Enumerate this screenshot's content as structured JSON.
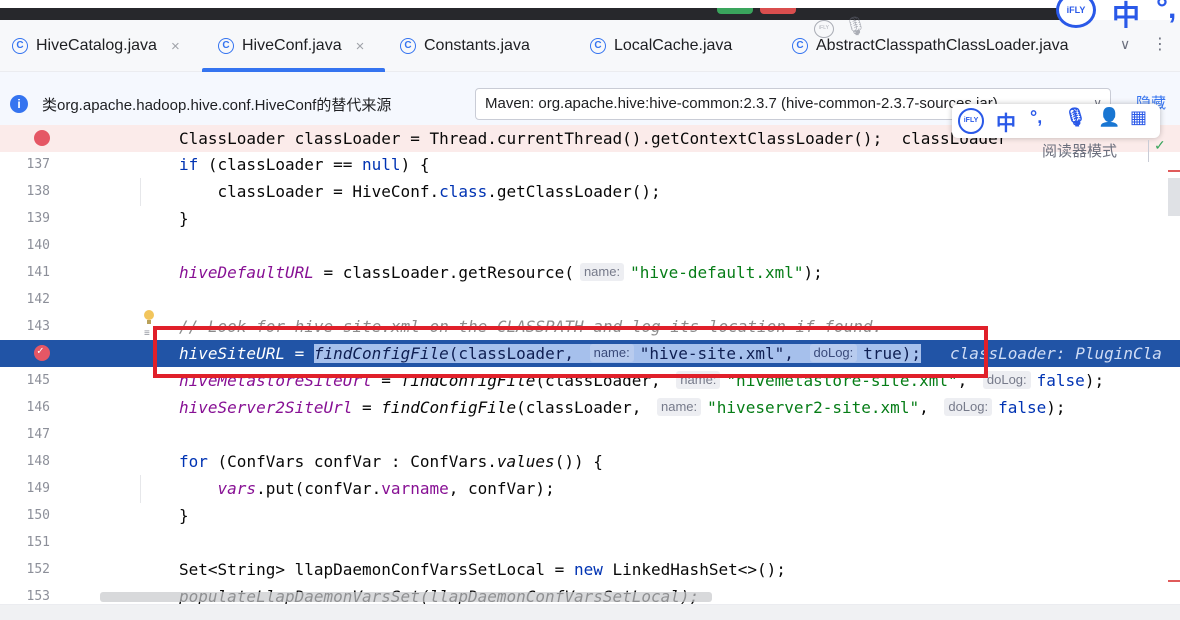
{
  "tabs": [
    {
      "label": "HiveCatalog.java",
      "closable": true,
      "active": false
    },
    {
      "label": "HiveConf.java",
      "closable": true,
      "active": true
    },
    {
      "label": "Constants.java",
      "closable": false,
      "active": false
    },
    {
      "label": "LocalCache.java",
      "closable": false,
      "active": false
    },
    {
      "label": "AbstractClasspathClassLoader.java",
      "closable": false,
      "active": false
    }
  ],
  "tab_icon_glyph": "C",
  "info_bar": {
    "message": "类org.apache.hadoop.hive.conf.HiveConf的替代来源",
    "source_select_value": "Maven: org.apache.hive:hive-common:2.3.7 (hive-common-2.3.7-sources.jar)",
    "hide_link": "隐藏"
  },
  "ifly": {
    "logo_text": "iFLY",
    "lang_label": "中",
    "punct_label": "°,",
    "reader_mode": "阅读器模式"
  },
  "code_lines": [
    {
      "no": "",
      "text": "ClassLoader classLoader = Thread.currentThread().getContextClassLoader();  classLoader"
    },
    {
      "no": "137",
      "text": "if (classLoader == null) {"
    },
    {
      "no": "138",
      "text": "classLoader = HiveConf.class.getClassLoader();"
    },
    {
      "no": "139",
      "text": "}"
    },
    {
      "no": "140",
      "text": ""
    },
    {
      "no": "141",
      "hint_name": "name:",
      "str": "\"hive-default.xml\""
    },
    {
      "no": "142",
      "text": ""
    },
    {
      "no": "143",
      "text": "// Look for hive-site.xml on the CLASSPATH and log its location if found."
    },
    {
      "no": "",
      "hint_name": "name:",
      "str": "\"hive-site.xml\"",
      "hint_dolog": "doLog:",
      "bool": "true",
      "debug": "classLoader: PluginCla"
    },
    {
      "no": "145",
      "hint_name": "name:",
      "str": "\"hivemetastore-site.xml\"",
      "hint_dolog": "doLog:",
      "bool": "false"
    },
    {
      "no": "146",
      "hint_name": "name:",
      "str": "\"hiveserver2-site.xml\"",
      "hint_dolog": "doLog:",
      "bool": "false"
    },
    {
      "no": "147",
      "text": ""
    },
    {
      "no": "148",
      "text": "for (ConfVars confVar : ConfVars.values()) {"
    },
    {
      "no": "149",
      "text": "vars.put(confVar.varname, confVar);"
    },
    {
      "no": "150",
      "text": "}"
    },
    {
      "no": "151",
      "text": ""
    },
    {
      "no": "152",
      "text": "Set<String> llapDaemonConfVarsSetLocal = new LinkedHashSet<>();"
    },
    {
      "no": "153",
      "text": "populateLlapDaemonVarsSet(llapDaemonConfVarsSetLocal);"
    }
  ],
  "colors": {
    "accent": "#3574f0",
    "execution_line": "#2154a6",
    "highlight_box": "#e0202a",
    "breakpoint": "#e55765"
  }
}
